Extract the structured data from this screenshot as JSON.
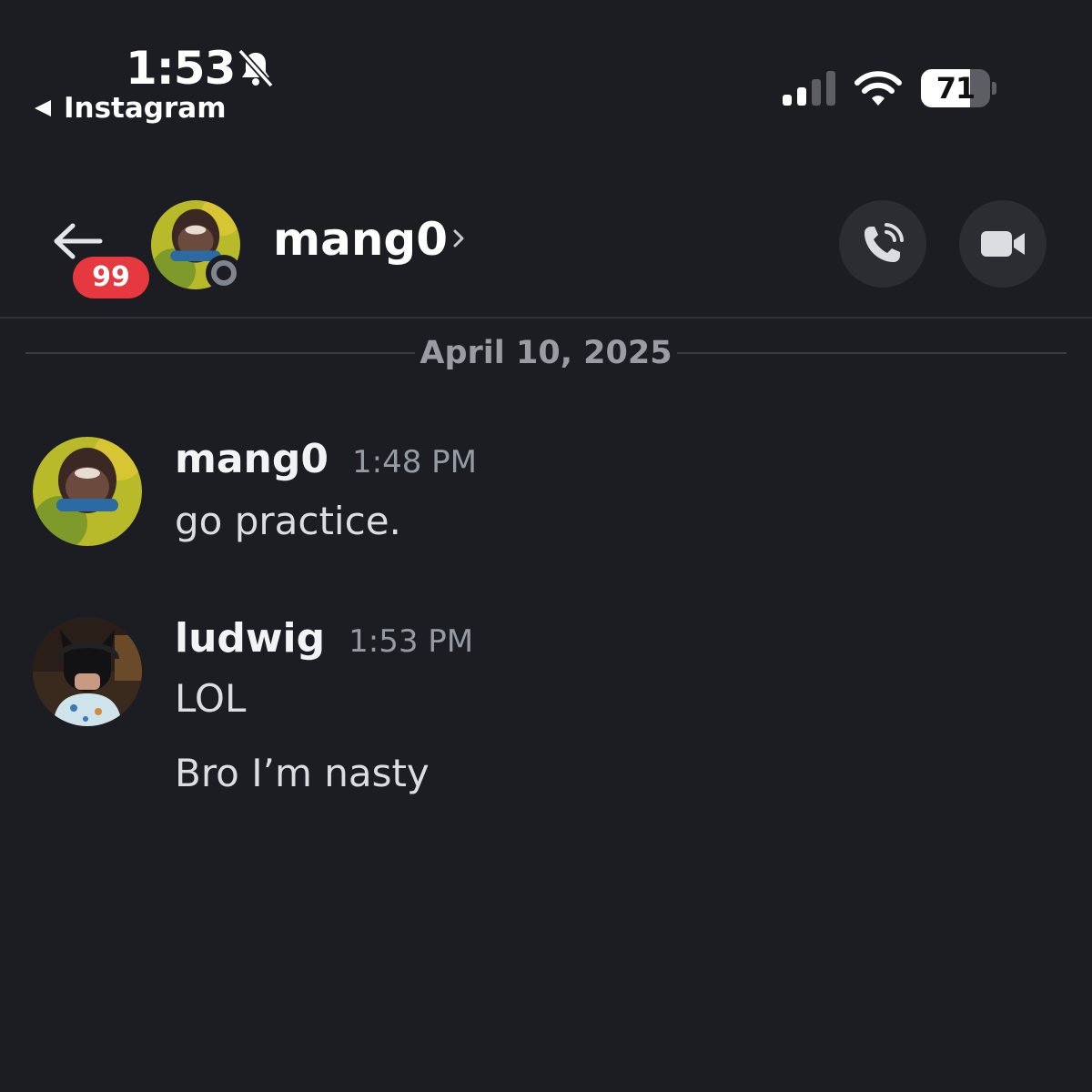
{
  "status_bar": {
    "time": "1:53",
    "back_app": "Instagram",
    "battery": "71",
    "battery_level": 0.71,
    "icons": [
      "bell-slash-icon",
      "signal-icon",
      "wifi-icon",
      "battery-icon"
    ]
  },
  "header": {
    "back_icon": "arrow-left-icon",
    "badge_count": "99",
    "name": "mang0",
    "chevron_icon": "chevron-right-icon",
    "call_icon": "phone-call-icon",
    "video_icon": "video-camera-icon"
  },
  "date_divider": "April 10, 2025",
  "messages": [
    {
      "author": "mang0",
      "time": "1:48 PM",
      "lines": [
        "go practice."
      ]
    },
    {
      "author": "ludwig",
      "time": "1:53 PM",
      "lines": [
        "LOL",
        "Bro I’m nasty"
      ]
    }
  ],
  "colors": {
    "background": "#1c1d22",
    "badge": "#e5383f",
    "button_bg": "#2b2d33",
    "muted_text": "#949ba4"
  }
}
